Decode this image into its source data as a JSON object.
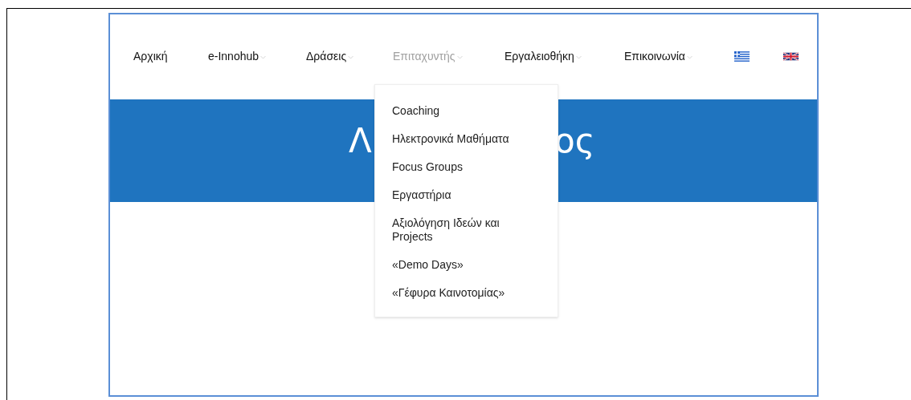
{
  "nav": {
    "items": [
      {
        "label": "Αρχική",
        "has_submenu": false,
        "selected": false
      },
      {
        "label": "e-Innohub",
        "has_submenu": true,
        "selected": false
      },
      {
        "label": "Δράσεις",
        "has_submenu": true,
        "selected": false
      },
      {
        "label": "Επιταχυντής",
        "has_submenu": true,
        "selected": true
      },
      {
        "label": "Εργαλειοθήκη",
        "has_submenu": true,
        "selected": false
      },
      {
        "label": "Επικοινωνία",
        "has_submenu": true,
        "selected": false
      }
    ],
    "languages": [
      {
        "kind": "greek"
      },
      {
        "kind": "english"
      }
    ]
  },
  "dropdown": {
    "items": [
      "Coaching",
      "Ηλεκτρονικά Μαθήματα",
      "Focus Groups",
      "Εργαστήρια",
      "Αξιολόγηση Ιδεών και Projects",
      "«Demo Days»",
      "«Γέφυρα Καινοτομίας»"
    ]
  },
  "banner": {
    "title_fragments": [
      "Λ",
      "ος"
    ]
  }
}
